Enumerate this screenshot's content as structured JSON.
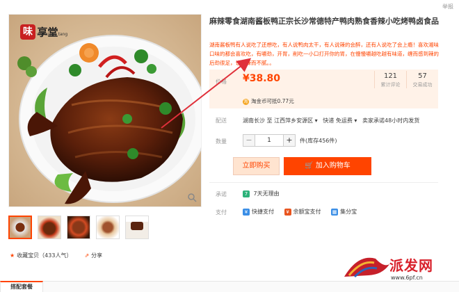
{
  "header": {
    "report_label": "举报"
  },
  "gallery": {
    "logo_char": "味",
    "logo_text": "享堂",
    "logo_sub": "wei xiang tang",
    "thumbnail_count": 5,
    "active_thumbnail_index": 0
  },
  "product": {
    "title": "麻辣零食湖南酱板鸭正宗长沙常德特产鸭肉熟食香辣小吃烤鸭卤食品",
    "subtitle": "湖南酱板鸭有人说吃了还想吃，有人说鸭肉太干，有人说辣的会醉，还有人说吃了会上瘾！喜欢湘味口味的都会喜欢吃，有嚼劲，开胃，削吃一小口打开你的胃，在慢慢嚼越吃越有味道，缠而感到辣的后劲很足，让你辣而不腻。。"
  },
  "price": {
    "label": "价格",
    "currency": "¥",
    "value": "38.80",
    "review_count": "121",
    "review_label": "累计评论",
    "sales_count": "57",
    "sales_label": "交易成功",
    "coin_icon": "淘",
    "coin_text": "淘金币可抵0.77元"
  },
  "delivery": {
    "label": "配送",
    "from": "湖南长沙",
    "to_prefix": "至",
    "to": "江西萍乡安源区",
    "shipping": "快递 免运费",
    "promise": "卖家承诺48小时内发货"
  },
  "quantity": {
    "label": "数量",
    "minus": "−",
    "value": "1",
    "plus": "+",
    "stock_text": "件(库存456件)"
  },
  "actions": {
    "buy_now": "立即购买",
    "add_to_cart": "加入购物车"
  },
  "promise": {
    "label": "承诺",
    "item": "7天无理由",
    "icon_char": "7"
  },
  "payment": {
    "label": "支付",
    "methods": [
      {
        "name": "快捷支付",
        "color": "#3a8ee6"
      },
      {
        "name": "余额宝支付",
        "color": "#e8541e"
      },
      {
        "name": "集分宝",
        "color": "#3a8ee6"
      }
    ]
  },
  "footer_links": {
    "favorite": "收藏宝贝（433人气）",
    "share": "分享"
  },
  "tabs": {
    "package": "搭配套餐"
  },
  "watermark": {
    "text": "派发网",
    "url": "www.6pf.cn"
  },
  "colors": {
    "accent": "#ff4400",
    "price_bg": "#fff2e8",
    "arrow": "#e0303a"
  }
}
